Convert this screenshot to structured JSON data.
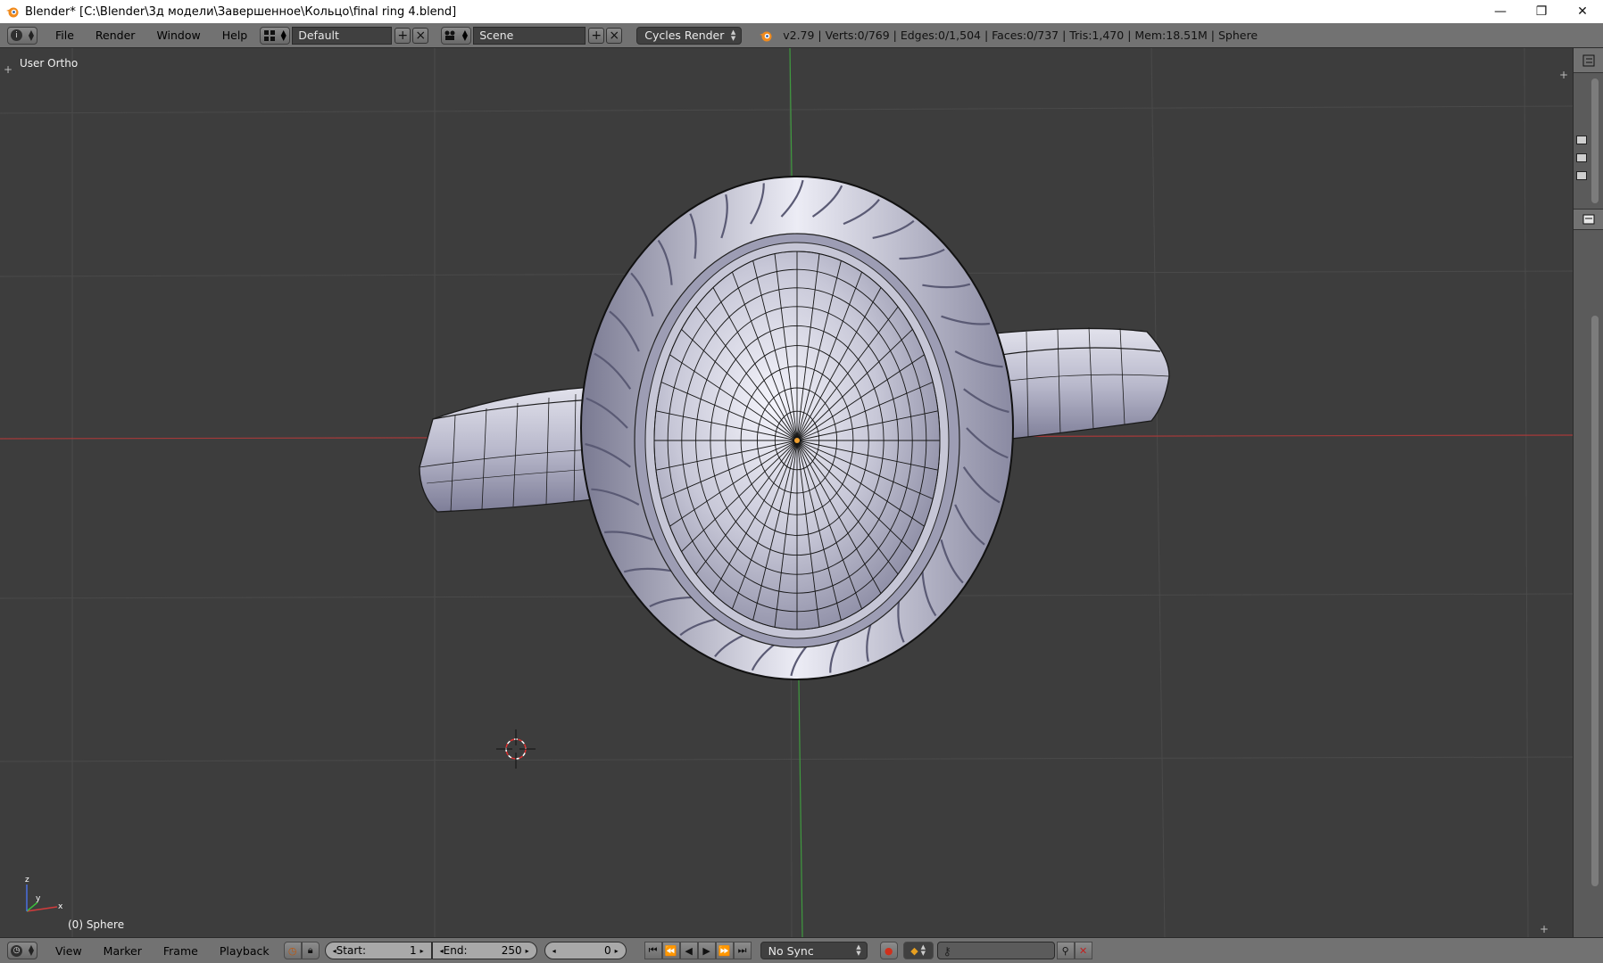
{
  "window": {
    "title": "Blender* [C:\\Blender\\3д модели\\Завершенное\\Кольцо\\final ring  4.blend]",
    "minimize_glyph": "—",
    "maximize_glyph": "❐",
    "close_glyph": "✕"
  },
  "info_header": {
    "editor_type_icon": "info-icon",
    "menus": [
      "File",
      "Render",
      "Window",
      "Help"
    ],
    "screen_layout": "Default",
    "scene": "Scene",
    "render_engine": "Cycles Render",
    "stats": "v2.79 | Verts:0/769 | Edges:0/1,504 | Faces:0/737 | Tris:1,470 | Mem:18.51M | Sphere"
  },
  "viewport": {
    "view_label": "User Ortho",
    "object_label": "(0) Sphere",
    "axis_labels": {
      "x": "x",
      "y": "y",
      "z": "z"
    },
    "colors": {
      "background": "#3d3d3d",
      "grid": "#4a4a4a",
      "x_axis": "#a53a3a",
      "y_axis": "#3f9a3f",
      "mesh_light": "#d2d2e0",
      "mesh_dark": "#6d6d88"
    }
  },
  "timeline": {
    "menus": [
      "View",
      "Marker",
      "Frame",
      "Playback"
    ],
    "start_label": "Start:",
    "start_value": "1",
    "end_label": "End:",
    "end_value": "250",
    "current_frame": "0",
    "sync_mode": "No Sync"
  }
}
